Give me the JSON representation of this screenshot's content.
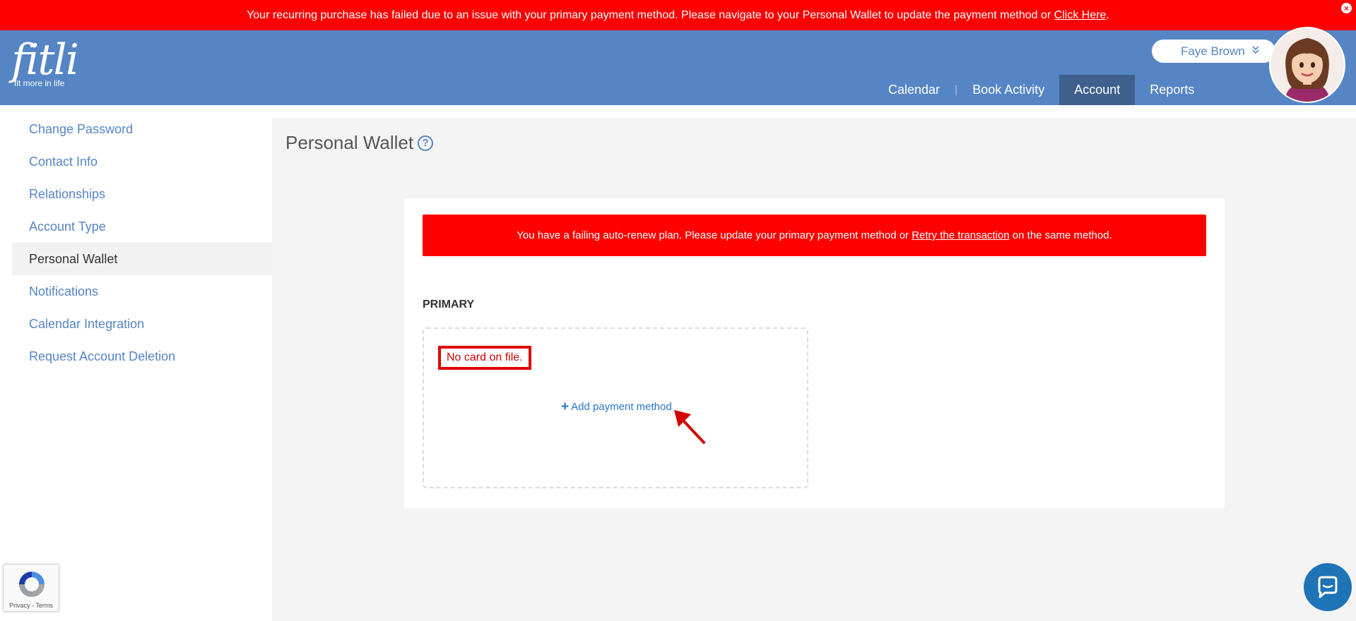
{
  "top_alert": {
    "message": "Your recurring purchase has failed due to an issue with your primary payment method. Please navigate to your Personal Wallet to update the payment method or",
    "link": "Click Here",
    "suffix": "."
  },
  "header": {
    "logo_word": "fitli",
    "logo_tagline": "fit more in life",
    "user_name": "Faye Brown",
    "nav": [
      {
        "label": "Calendar"
      },
      {
        "label": "|"
      },
      {
        "label": "Book Activity"
      },
      {
        "label": "Account",
        "active": true
      },
      {
        "label": "Reports"
      }
    ]
  },
  "sidebar": {
    "items": [
      {
        "label": "Change Password"
      },
      {
        "label": "Contact Info"
      },
      {
        "label": "Relationships"
      },
      {
        "label": "Account Type"
      },
      {
        "label": "Personal Wallet",
        "active": true
      },
      {
        "label": "Notifications"
      },
      {
        "label": "Calendar Integration"
      },
      {
        "label": "Request Account Deletion"
      }
    ]
  },
  "main": {
    "title": "Personal Wallet",
    "help_icon": "?",
    "alert": {
      "message": "You have a failing auto-renew plan. Please update your primary payment method or",
      "link": "Retry the transaction",
      "suffix": "on the same method."
    },
    "primary_label": "PRIMARY",
    "no_card": "No card on file.",
    "add_payment": "Add payment method"
  },
  "recaptcha": {
    "text": "Privacy - Terms"
  },
  "colors": {
    "alert_red": "#ff0000",
    "header_blue": "#5585c5",
    "nav_active": "#3f5f8c",
    "link_blue": "#2a76c8",
    "chat_blue": "#1f73b7"
  },
  "icons": {
    "close": "close-icon",
    "help": "help-icon",
    "chevron": "chevron-double-down-icon",
    "plus": "plus-icon",
    "arrow": "arrow-annotation-icon",
    "chat": "chat-icon",
    "recaptcha": "recaptcha-icon"
  }
}
